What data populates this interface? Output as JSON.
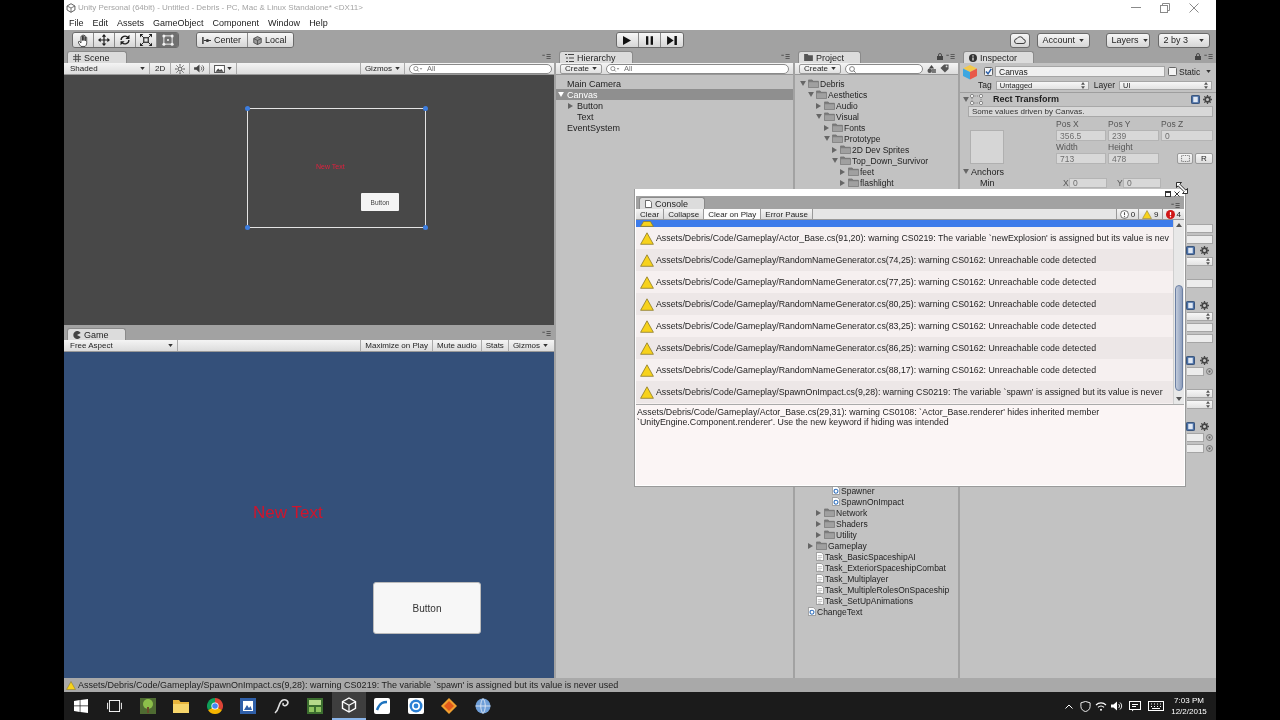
{
  "window": {
    "title": "Unity Personal (64bit) - Untitled - Debris - PC, Mac & Linux Standalone* <DX11>"
  },
  "menu": [
    "File",
    "Edit",
    "Assets",
    "GameObject",
    "Component",
    "Window",
    "Help"
  ],
  "toolbar": {
    "tools": [
      {
        "kind": "hand",
        "selected": false
      },
      {
        "kind": "move",
        "selected": false
      },
      {
        "kind": "rotate",
        "selected": false
      },
      {
        "kind": "scale",
        "selected": false
      },
      {
        "kind": "rect",
        "selected": true
      }
    ],
    "pivot": [
      {
        "kind": "pivot",
        "label": "Center"
      },
      {
        "kind": "space",
        "label": "Local"
      }
    ],
    "playback": [
      {
        "kind": "play"
      },
      {
        "kind": "pause"
      },
      {
        "kind": "step"
      }
    ],
    "account": "Account",
    "layers": "Layers",
    "layout": "2 by 3"
  },
  "scene": {
    "tab": "Scene",
    "shading": "Shaded",
    "mode": "2D",
    "gizmos": "Gizmos",
    "search": {
      "placeholder": "All"
    },
    "canvas": {
      "text": "New Text",
      "button": "Button"
    }
  },
  "game": {
    "tab": "Game",
    "aspect": "Free Aspect",
    "options": [
      "Maximize on Play",
      "Mute audio",
      "Stats"
    ],
    "gizmos": "Gizmos",
    "text": "New Text",
    "button": "Button"
  },
  "hierarchy": {
    "tab": "Hierarchy",
    "create": "Create",
    "search": {
      "placeholder": "All"
    },
    "items": [
      {
        "label": "Main Camera",
        "selected": false
      },
      {
        "label": "Canvas",
        "selected": true,
        "expanded": true,
        "children": [
          {
            "label": "Button",
            "selected": false,
            "expanded": false
          },
          {
            "label": "Text",
            "selected": false
          }
        ]
      },
      {
        "label": "EventSystem",
        "selected": false
      }
    ]
  },
  "project": {
    "tab": "Project",
    "create": "Create",
    "tree": [
      {
        "kind": "folder",
        "label": "Debris",
        "expanded": true,
        "children": [
          {
            "kind": "folder",
            "label": "Aesthetics",
            "expanded": true,
            "children": [
              {
                "kind": "folder",
                "label": "Audio",
                "expanded": false
              },
              {
                "kind": "folder",
                "label": "Visual",
                "expanded": true,
                "children": [
                  {
                    "kind": "folder",
                    "label": "Fonts",
                    "expanded": false
                  },
                  {
                    "kind": "folder",
                    "label": "Prototype",
                    "expanded": true,
                    "children": [
                      {
                        "kind": "folder",
                        "label": "2D Dev Sprites",
                        "expanded": false
                      },
                      {
                        "kind": "folder",
                        "label": "Top_Down_Survivor",
                        "expanded": true,
                        "children": [
                          {
                            "kind": "folder",
                            "label": "feet",
                            "expanded": false
                          },
                          {
                            "kind": "folder",
                            "label": "flashlight",
                            "expanded": false
                          }
                        ]
                      }
                    ]
                  }
                ]
              }
            ]
          },
          {
            "kind": "covered",
            "children": [
              {
                "kind": "covered",
                "children": [
                  {
                    "kind": "script",
                    "label": "Spawner"
                  },
                  {
                    "kind": "script",
                    "label": "SpawnOnImpact"
                  }
                ]
              },
              {
                "kind": "folder",
                "label": "Network",
                "expanded": false
              },
              {
                "kind": "folder",
                "label": "Shaders",
                "expanded": false
              },
              {
                "kind": "folder",
                "label": "Utility",
                "expanded": false
              }
            ]
          },
          {
            "kind": "folder",
            "label": "Gameplay",
            "expanded": false
          },
          {
            "kind": "document",
            "label": "Task_BasicSpaceshipAI"
          },
          {
            "kind": "document",
            "label": "Task_ExteriorSpaceshipCombat"
          },
          {
            "kind": "document",
            "label": "Task_Multiplayer"
          },
          {
            "kind": "document",
            "label": "Task_MultipleRolesOnSpaceship"
          },
          {
            "kind": "document",
            "label": "Task_SetUpAnimations"
          }
        ]
      },
      {
        "kind": "script",
        "label": "ChangeText"
      }
    ]
  },
  "inspector": {
    "tab": "Inspector",
    "object": {
      "active": true,
      "name": "Canvas",
      "static": false,
      "static_label": "Static",
      "tag_label": "Tag",
      "tag": "Untagged",
      "layer_label": "Layer",
      "layer": "UI"
    },
    "component": {
      "title": "Rect Transform",
      "expanded": true,
      "note": "Some values driven by Canvas.",
      "rows": [
        {
          "fields": [
            {
              "label": "Pos X",
              "value": "356.5",
              "disabled": true
            },
            {
              "label": "Pos Y",
              "value": "239",
              "disabled": true
            },
            {
              "label": "Pos Z",
              "value": "0",
              "disabled": true
            }
          ]
        },
        {
          "fields": [
            {
              "label": "Width",
              "value": "713",
              "disabled": true
            },
            {
              "label": "Height",
              "value": "478",
              "disabled": true
            }
          ],
          "raw_button": "R"
        }
      ],
      "anchors": {
        "label": "Anchors",
        "expanded": true,
        "min": {
          "label": "Min",
          "fields": [
            {
              "label": "X",
              "value": "0",
              "disabled": true
            },
            {
              "label": "Y",
              "value": "0",
              "disabled": true
            }
          ]
        }
      }
    },
    "covered_rows": [
      {
        "kind": "gap"
      },
      {
        "kind": "gap"
      },
      {
        "kind": "gap"
      },
      {
        "kind": "field"
      },
      {
        "kind": "field"
      },
      {
        "kind": "component"
      },
      {
        "kind": "dropdown"
      },
      {
        "kind": "gap"
      },
      {
        "kind": "field"
      },
      {
        "kind": "gap"
      },
      {
        "kind": "component"
      },
      {
        "kind": "dropdown"
      },
      {
        "kind": "field"
      },
      {
        "kind": "field"
      },
      {
        "kind": "gap"
      },
      {
        "kind": "component"
      },
      {
        "kind": "object"
      },
      {
        "kind": "gap"
      },
      {
        "kind": "dropdown"
      },
      {
        "kind": "dropdown"
      },
      {
        "kind": "gap"
      },
      {
        "kind": "component"
      },
      {
        "kind": "object"
      },
      {
        "kind": "object"
      }
    ]
  },
  "console": {
    "tab": "Console",
    "buttons": [
      {
        "kind": "button",
        "label": "Clear"
      },
      {
        "kind": "toggle",
        "label": "Collapse",
        "on": false
      },
      {
        "kind": "toggle",
        "label": "Clear on Play",
        "on": true
      },
      {
        "kind": "toggle",
        "label": "Error Pause",
        "on": false
      }
    ],
    "counts": [
      {
        "kind": "info",
        "count": "0"
      },
      {
        "kind": "warning",
        "count": "9"
      },
      {
        "kind": "error",
        "count": "4"
      }
    ],
    "entries": [
      {
        "kind": "warning",
        "selected": true
      },
      {
        "kind": "warning",
        "selected": false,
        "message": "Assets/Debris/Code/Gameplay/Actor_Base.cs(91,20): warning CS0219: The variable `newExplosion' is assigned but its value is nev"
      },
      {
        "kind": "warning",
        "selected": false,
        "message": "Assets/Debris/Code/Gameplay/RandomNameGenerator.cs(74,25): warning CS0162: Unreachable code detected"
      },
      {
        "kind": "warning",
        "selected": false,
        "message": "Assets/Debris/Code/Gameplay/RandomNameGenerator.cs(77,25): warning CS0162: Unreachable code detected"
      },
      {
        "kind": "warning",
        "selected": false,
        "message": "Assets/Debris/Code/Gameplay/RandomNameGenerator.cs(80,25): warning CS0162: Unreachable code detected"
      },
      {
        "kind": "warning",
        "selected": false,
        "message": "Assets/Debris/Code/Gameplay/RandomNameGenerator.cs(83,25): warning CS0162: Unreachable code detected"
      },
      {
        "kind": "warning",
        "selected": false,
        "message": "Assets/Debris/Code/Gameplay/RandomNameGenerator.cs(86,25): warning CS0162: Unreachable code detected"
      },
      {
        "kind": "warning",
        "selected": false,
        "message": "Assets/Debris/Code/Gameplay/RandomNameGenerator.cs(88,17): warning CS0162: Unreachable code detected"
      },
      {
        "kind": "warning",
        "selected": false,
        "message": "Assets/Debris/Code/Gameplay/SpawnOnImpact.cs(9,28): warning CS0219: The variable `spawn' is assigned but its value is never"
      }
    ],
    "detail": "Assets/Debris/Code/Gameplay/Actor_Base.cs(29,31): warning CS0108: `Actor_Base.renderer' hides inherited member\n`UnityEngine.Component.renderer'. Use the new keyword if hiding was intended"
  },
  "status_bar": {
    "kind": "warning",
    "message": "Assets/Debris/Code/Gameplay/SpawnOnImpact.cs(9,28): warning CS0219: The variable `spawn' is assigned but its value is never used"
  },
  "taskbar": {
    "apps": [
      {
        "active": false
      },
      {
        "active": false
      },
      {
        "active": false
      },
      {
        "active": false
      },
      {
        "active": false
      },
      {
        "active": false
      },
      {
        "active": true
      },
      {
        "active": false
      },
      {
        "active": false
      },
      {
        "active": false
      },
      {
        "active": false
      }
    ],
    "time": "7:03 PM",
    "date": "12/2/2015"
  }
}
